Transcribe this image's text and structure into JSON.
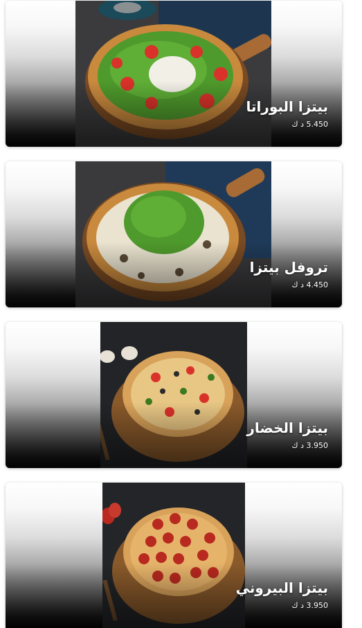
{
  "items": [
    {
      "name": "بيتزا البوراتا",
      "price": "5.450 د ك"
    },
    {
      "name": "تروفل بيتزا",
      "price": "4.450 د ك"
    },
    {
      "name": "بيتزا الخضار",
      "price": "3.950 د ك"
    },
    {
      "name": "بيتزا البيروني",
      "price": "3.950 د ك"
    }
  ],
  "colors": {
    "card_top": "#ffffff",
    "card_bottom": "#050505",
    "text": "#ffffff",
    "crust": "#c98a3e",
    "arugula": "#4f9a2c",
    "tomato": "#d9322a",
    "board": "#8a5a2b",
    "pepperoni": "#b8291f"
  }
}
